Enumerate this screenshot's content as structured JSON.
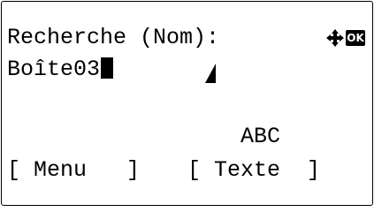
{
  "screen": {
    "title": "Recherche (Nom):",
    "entry_value": "Boîte03",
    "input_mode": "ABC",
    "icons": {
      "navigation": "four-way-arrow-icon",
      "confirm": "ok-icon",
      "confirm_label": "OK"
    }
  },
  "softkeys": {
    "left": "[ Menu   ]",
    "right": "[ Texte  ]"
  }
}
